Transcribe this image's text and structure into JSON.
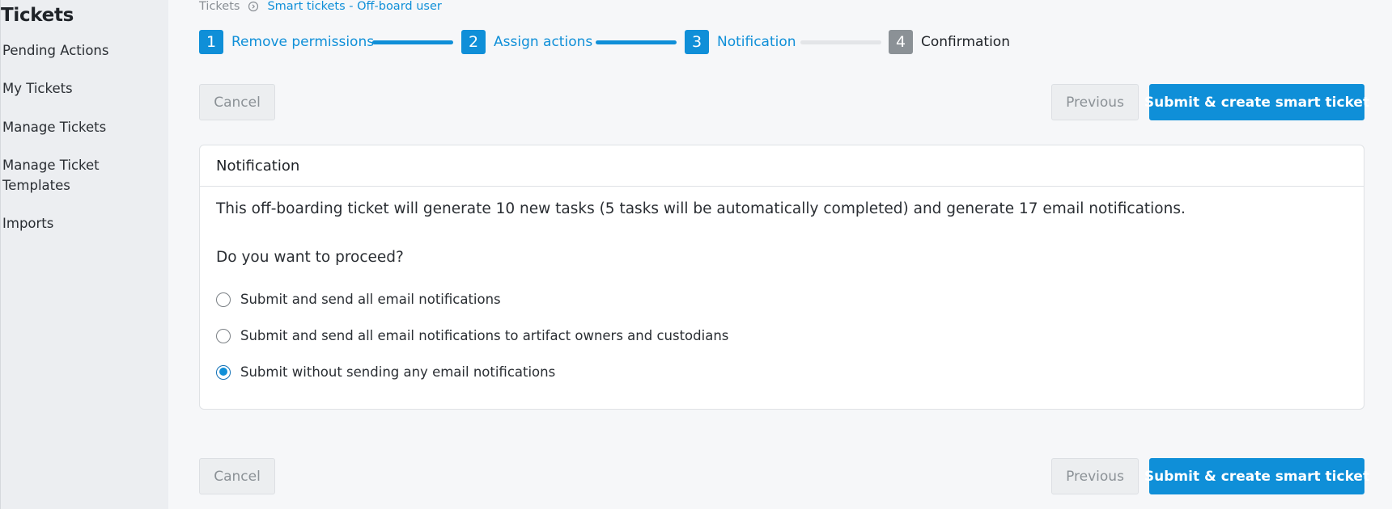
{
  "sidebar": {
    "title": "Tickets",
    "items": [
      {
        "label": "Pending Actions"
      },
      {
        "label": "My Tickets"
      },
      {
        "label": "Manage Tickets"
      },
      {
        "label": "Manage Ticket"
      },
      {
        "label": "Templates"
      },
      {
        "label": "Imports"
      }
    ]
  },
  "breadcrumb": {
    "root": "Tickets",
    "current": "Smart tickets - Off-board user"
  },
  "stepper": {
    "steps": [
      {
        "number": "1",
        "label": "Remove permissions",
        "state": "active"
      },
      {
        "number": "2",
        "label": "Assign actions",
        "state": "active"
      },
      {
        "number": "3",
        "label": "Notification",
        "state": "active"
      },
      {
        "number": "4",
        "label": "Confirmation",
        "state": "inactive"
      }
    ]
  },
  "actions": {
    "cancel_label": "Cancel",
    "previous_label": "Previous",
    "submit_label": "Submit & create smart ticket"
  },
  "card": {
    "title": "Notification",
    "message": "This off-boarding ticket will generate 10 new tasks (5 tasks will be automatically completed) and generate 17 email notifications.",
    "question": "Do you want to proceed?",
    "options": [
      {
        "label": "Submit and send all email notifications",
        "selected": false
      },
      {
        "label": "Submit and send all email notifications to artifact owners and custodians",
        "selected": false
      },
      {
        "label": "Submit without sending any email notifications",
        "selected": true
      }
    ]
  },
  "colors": {
    "accent": "#0f8fd8",
    "inactive_step": "#8b9196"
  }
}
